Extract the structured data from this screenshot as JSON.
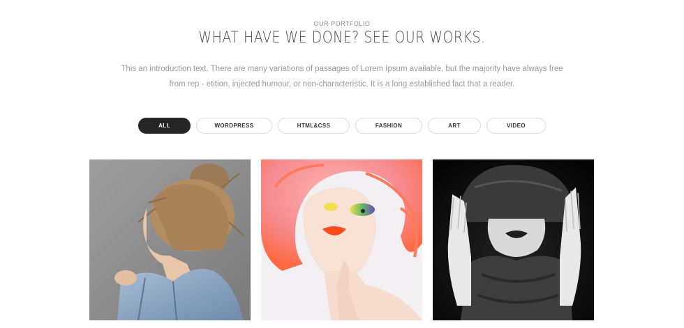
{
  "section": {
    "eyebrow": "OUR PORTFOLIO",
    "title": "WHAT HAVE WE DONE? SEE OUR WORKS.",
    "intro": "This an introduction text. There are many variations of passages of Lorem Ipsum available, but the majority have always free from rep - etition, injected humour, or non-characteristic. It is a long established fact that a reader."
  },
  "filters": [
    {
      "label": "ALL",
      "active": true
    },
    {
      "label": "WORDPRESS",
      "active": false
    },
    {
      "label": "HTML&CSS",
      "active": false
    },
    {
      "label": "FASHION",
      "active": false
    },
    {
      "label": "ART",
      "active": false
    },
    {
      "label": "VIDEO",
      "active": false
    }
  ],
  "portfolio": {
    "items": [
      {
        "image": "woman-messy-bun-denim-jacket-photo"
      },
      {
        "image": "woman-pink-hair-colorful-makeup-photo"
      },
      {
        "image": "woman-black-hood-monochrome-photo"
      }
    ]
  },
  "colors": {
    "active_filter_bg": "#262626",
    "filter_border": "#dcdcdc",
    "title_text": "#4a4a4a",
    "body_text": "#9a9a9a"
  }
}
